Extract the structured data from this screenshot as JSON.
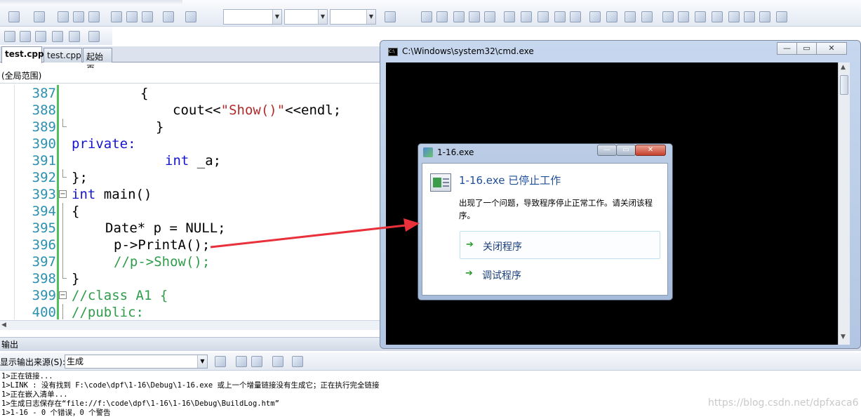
{
  "tabs": [
    "test.cpp",
    "test.cpp",
    "起始页"
  ],
  "scope": "(全局范围)",
  "code_lines": [
    {
      "num": "387",
      "text": "{",
      "indent": 200,
      "cls": ""
    },
    {
      "num": "388",
      "text": "cout<<\"Show()\"<<endl;",
      "indent": 246,
      "cls": "mixed"
    },
    {
      "num": "389",
      "text": "}",
      "indent": 222,
      "cls": ""
    },
    {
      "num": "390",
      "text": "private:",
      "indent": 102,
      "cls": "kw"
    },
    {
      "num": "391",
      "text": "int _a;",
      "indent": 235,
      "cls": "mixed-int"
    },
    {
      "num": "392",
      "text": "};",
      "indent": 102,
      "cls": ""
    },
    {
      "num": "393",
      "text": "int main()",
      "indent": 102,
      "cls": "mixed-int"
    },
    {
      "num": "394",
      "text": "{",
      "indent": 102,
      "cls": ""
    },
    {
      "num": "395",
      "text": "Date* p = NULL;",
      "indent": 150,
      "cls": ""
    },
    {
      "num": "396",
      "text": "p->PrintA();",
      "indent": 162,
      "cls": ""
    },
    {
      "num": "397",
      "text": "//p->Show();",
      "indent": 162,
      "cls": "cm"
    },
    {
      "num": "398",
      "text": "}",
      "indent": 102,
      "cls": ""
    },
    {
      "num": "399",
      "text": "//class A1 {",
      "indent": 102,
      "cls": "cm"
    },
    {
      "num": "400",
      "text": "//public:",
      "indent": 102,
      "cls": "cm"
    }
  ],
  "output": {
    "panel_title": "输出",
    "source_label": "显示输出来源(S):",
    "source_value": "生成",
    "lines": [
      "1>正在链接...",
      "1>LINK : 没有找到 F:\\code\\dpf\\1-16\\Debug\\1-16.exe 或上一个增量链接没有生成它；正在执行完全链接",
      "1>正在嵌入清单...",
      "1>生成日志保存在“file://f:\\code\\dpf\\1-16\\1-16\\Debug\\BuildLog.htm”",
      "1>1-16 - 0 个错误，0 个警告"
    ]
  },
  "cmd_window": {
    "title": "C:\\Windows\\system32\\cmd.exe"
  },
  "crash_dialog": {
    "title": "1-16.exe",
    "heading": "1-16.exe 已停止工作",
    "message": "出现了一个问题，导致程序停止正常工作。请关闭该程序。",
    "close_option": "关闭程序",
    "debug_option": "调试程序"
  },
  "watermark": "https://blog.csdn.net/dpfxaca6",
  "colors": {
    "cmd_bg": "#000000",
    "dialog_title": "#1f4e9a",
    "arrow": "#e8313a"
  }
}
